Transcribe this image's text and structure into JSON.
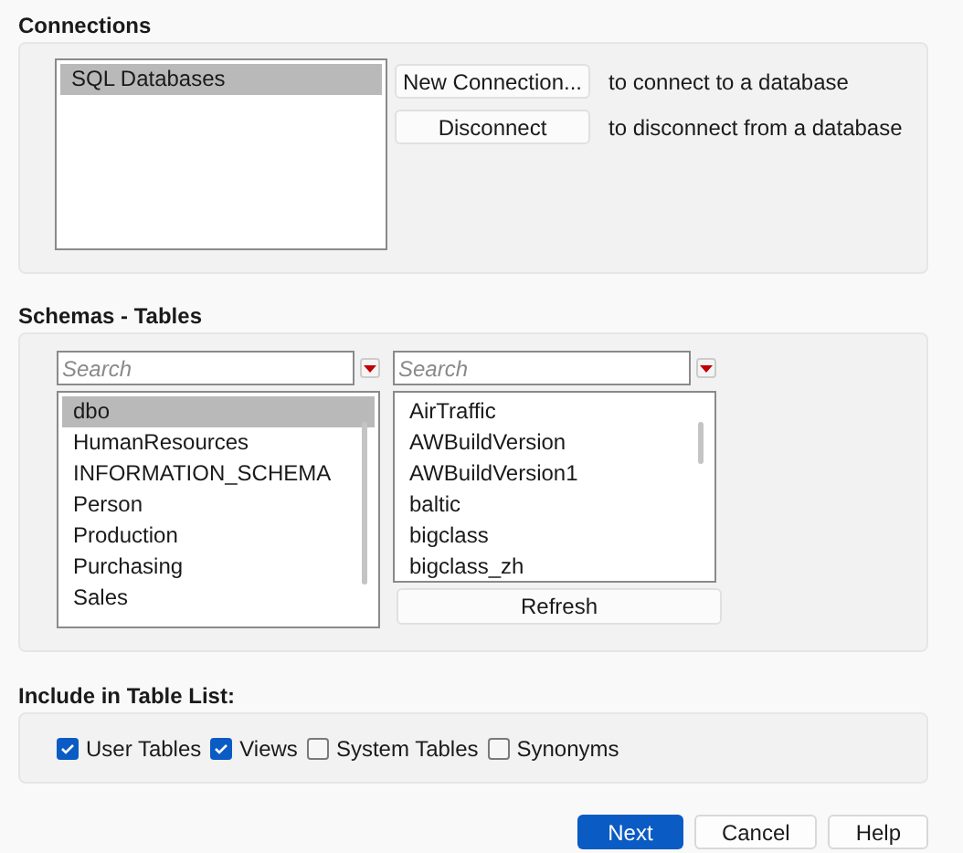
{
  "connections": {
    "heading": "Connections",
    "items": [
      {
        "label": "SQL Databases",
        "selected": true
      }
    ],
    "actions": [
      {
        "button": "New Connection...",
        "description": "to connect to a database"
      },
      {
        "button": "Disconnect",
        "description": "to disconnect from a database"
      }
    ]
  },
  "schemas_tables": {
    "heading": "Schemas - Tables",
    "schemas": {
      "search": {
        "placeholder": "Search"
      },
      "items": [
        {
          "label": "dbo",
          "selected": true
        },
        {
          "label": "HumanResources",
          "selected": false
        },
        {
          "label": "INFORMATION_SCHEMA",
          "selected": false
        },
        {
          "label": "Person",
          "selected": false
        },
        {
          "label": "Production",
          "selected": false
        },
        {
          "label": "Purchasing",
          "selected": false
        },
        {
          "label": "Sales",
          "selected": false
        }
      ]
    },
    "tables": {
      "search": {
        "placeholder": "Search"
      },
      "items": [
        {
          "label": "AirTraffic",
          "selected": false
        },
        {
          "label": "AWBuildVersion",
          "selected": false
        },
        {
          "label": "AWBuildVersion1",
          "selected": false
        },
        {
          "label": "baltic",
          "selected": false
        },
        {
          "label": "bigclass",
          "selected": false
        },
        {
          "label": "bigclass_zh",
          "selected": false
        }
      ]
    },
    "refresh": "Refresh"
  },
  "include": {
    "heading": "Include in Table List:",
    "options": [
      {
        "label": "User Tables",
        "checked": true
      },
      {
        "label": "Views",
        "checked": true
      },
      {
        "label": "System Tables",
        "checked": false
      },
      {
        "label": "Synonyms",
        "checked": false
      }
    ]
  },
  "buttons": [
    {
      "label": "Next",
      "primary": true
    },
    {
      "label": "Cancel",
      "primary": false
    },
    {
      "label": "Help",
      "primary": false
    }
  ]
}
